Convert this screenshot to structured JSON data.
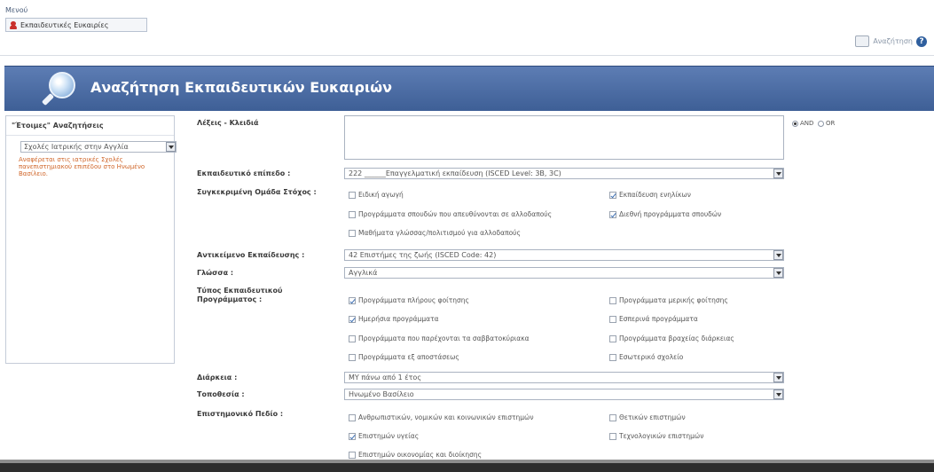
{
  "topbar": {
    "menu_label": "Μενού",
    "tab_label": "Εκπαιδευτικές Ευκαιρίες",
    "search_label": "Αναζήτηση",
    "help_label": "?"
  },
  "banner": {
    "title": "Αναζήτηση Εκπαιδευτικών Ευκαιριών"
  },
  "sidebar": {
    "title": "\"Έτοιμες\" Αναζητήσεις",
    "select_value": "Σχολές Ιατρικής στην Αγγλία",
    "note": "Αναφέρεται στις ιατρικές Σχολές πανεπιστημιακού επιπέδου στο Ηνωμένο Βασίλειο."
  },
  "form": {
    "keywords_label": "Λέξεις - Κλειδιά",
    "keywords_value": "",
    "logic": {
      "and_label": "AND",
      "or_label": "OR",
      "selected": "AND"
    },
    "level_label": "Εκπαιδευτικό επίπεδο :",
    "level_value": "222 ______Επαγγελματική εκπαίδευση (ISCED Level: 3B, 3C)",
    "target_label": "Συγκεκριμένη Ομάδα Στόχος :",
    "target_options": [
      {
        "label": "Ειδική αγωγή",
        "checked": false
      },
      {
        "label": "Εκπαίδευση ενηλίκων",
        "checked": true
      },
      {
        "label": "Προγράμματα σπουδών που απευθύνονται σε αλλοδαπούς",
        "checked": false
      },
      {
        "label": "Διεθνή προγράμματα σπουδών",
        "checked": true
      },
      {
        "label": "Μαθήματα γλώσσας/πολιτισμού για αλλοδαπούς",
        "checked": false
      }
    ],
    "subject_label": "Αντικείμενο Εκπαίδευσης :",
    "subject_value": "42 Επιστήμες της ζωής (ISCED Code: 42)",
    "language_label": "Γλώσσα :",
    "language_value": "Αγγλικά",
    "programme_label": "Τύπος Εκπαιδευτικού Προγράμματος :",
    "programme_options": [
      {
        "label": "Προγράμματα πλήρους φοίτησης",
        "checked": true
      },
      {
        "label": "Προγράμματα μερικής φοίτησης",
        "checked": false
      },
      {
        "label": "Ημερήσια προγράμματα",
        "checked": true
      },
      {
        "label": "Εσπερινά προγράμματα",
        "checked": false
      },
      {
        "label": "Προγράμματα που παρέχονται τα σαββατοκύριακα",
        "checked": false
      },
      {
        "label": "Προγράμματα βραχείας διάρκειας",
        "checked": false
      },
      {
        "label": "Προγράμματα εξ αποστάσεως",
        "checked": false
      },
      {
        "label": "Εσωτερικό σχολείο",
        "checked": false
      }
    ],
    "duration_label": "Διάρκεια :",
    "duration_value": "ΜΥ πάνω από 1 έτος",
    "location_label": "Τοποθεσία :",
    "location_value": "Ηνωμένο Βασίλειο",
    "field_label": "Επιστημονικό Πεδίο :",
    "field_options": [
      {
        "label": "Ανθρωπιστικών, νομικών και κοινωνικών επιστημών",
        "checked": false
      },
      {
        "label": "Θετικών επιστημών",
        "checked": false
      },
      {
        "label": "Επιστημών υγείας",
        "checked": true
      },
      {
        "label": "Τεχνολογικών επιστημών",
        "checked": false
      },
      {
        "label": "Επιστημών οικονομίας και διοίκησης",
        "checked": false
      }
    ]
  },
  "colors": {
    "banner": "#4a6ba3",
    "note": "#d0662a",
    "link_blue": "#2f5f9e"
  }
}
